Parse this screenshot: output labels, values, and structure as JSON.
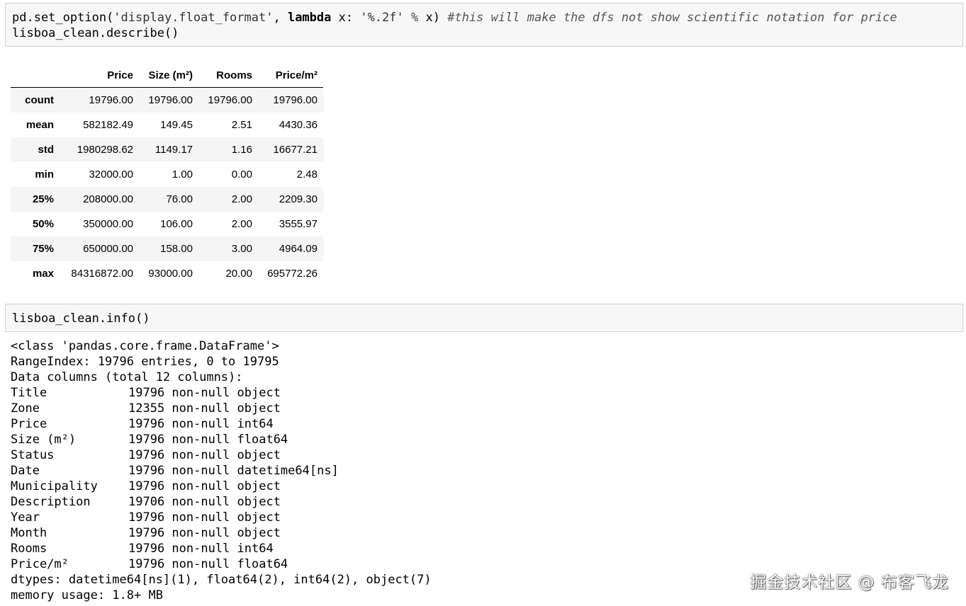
{
  "cell1": {
    "line1": {
      "prefix": "pd.set_option(",
      "arg": "'display.float_format'",
      "sep": ", ",
      "kw": "lambda",
      "mid": " x: ",
      "fmt": "'%.2f'",
      "op": " % ",
      "end": "x) ",
      "comment": "#this will make the dfs not show scientific notation for price"
    },
    "line2": "lisboa_clean.describe()"
  },
  "describe": {
    "columns": [
      "Price",
      "Size (m²)",
      "Rooms",
      "Price/m²"
    ],
    "rows": [
      {
        "label": "count",
        "values": [
          "19796.00",
          "19796.00",
          "19796.00",
          "19796.00"
        ]
      },
      {
        "label": "mean",
        "values": [
          "582182.49",
          "149.45",
          "2.51",
          "4430.36"
        ]
      },
      {
        "label": "std",
        "values": [
          "1980298.62",
          "1149.17",
          "1.16",
          "16677.21"
        ]
      },
      {
        "label": "min",
        "values": [
          "32000.00",
          "1.00",
          "0.00",
          "2.48"
        ]
      },
      {
        "label": "25%",
        "values": [
          "208000.00",
          "76.00",
          "2.00",
          "2209.30"
        ]
      },
      {
        "label": "50%",
        "values": [
          "350000.00",
          "106.00",
          "2.00",
          "3555.97"
        ]
      },
      {
        "label": "75%",
        "values": [
          "650000.00",
          "158.00",
          "3.00",
          "4964.09"
        ]
      },
      {
        "label": "max",
        "values": [
          "84316872.00",
          "93000.00",
          "20.00",
          "695772.26"
        ]
      }
    ]
  },
  "cell2": {
    "code": "lisboa_clean.info()"
  },
  "info": {
    "header": [
      "<class 'pandas.core.frame.DataFrame'>",
      "RangeIndex: 19796 entries, 0 to 19795",
      "Data columns (total 12 columns):"
    ],
    "columns": [
      {
        "name": "Title",
        "desc": "19796 non-null object"
      },
      {
        "name": "Zone",
        "desc": "12355 non-null object"
      },
      {
        "name": "Price",
        "desc": "19796 non-null int64"
      },
      {
        "name": "Size (m²)",
        "desc": "19796 non-null float64"
      },
      {
        "name": "Status",
        "desc": "19796 non-null object"
      },
      {
        "name": "Date",
        "desc": "19796 non-null datetime64[ns]"
      },
      {
        "name": "Municipality",
        "desc": "19796 non-null object"
      },
      {
        "name": "Description",
        "desc": "19706 non-null object"
      },
      {
        "name": "Year",
        "desc": "19796 non-null object"
      },
      {
        "name": "Month",
        "desc": "19796 non-null object"
      },
      {
        "name": "Rooms",
        "desc": "19796 non-null int64"
      },
      {
        "name": "Price/m²",
        "desc": "19796 non-null float64"
      }
    ],
    "footer": [
      "dtypes: datetime64[ns](1), float64(2), int64(2), object(7)",
      "memory usage: 1.8+ MB"
    ]
  },
  "watermark": "掘金技术社区 @ 布客飞龙"
}
